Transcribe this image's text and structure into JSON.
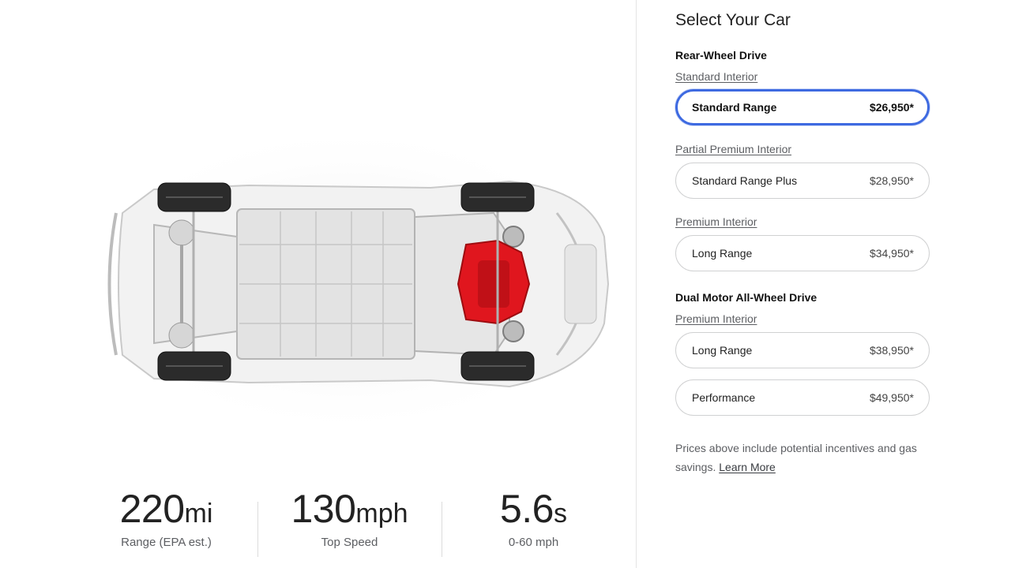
{
  "specs": [
    {
      "value": "220",
      "unit": "mi",
      "label": "Range (EPA est.)"
    },
    {
      "value": "130",
      "unit": "mph",
      "label": "Top Speed"
    },
    {
      "value": "5.6",
      "unit": "s",
      "label": "0-60 mph"
    }
  ],
  "configurator": {
    "title": "Select Your Car",
    "group_rwd": "Rear-Wheel Drive",
    "group_awd": "Dual Motor All-Wheel Drive",
    "interior_standard": "Standard Interior",
    "interior_partial": "Partial Premium Interior",
    "interior_premium_rwd": "Premium Interior",
    "interior_premium_awd": "Premium Interior",
    "options": [
      {
        "name": "Standard Range",
        "price": "$26,950*",
        "selected": true
      },
      {
        "name": "Standard Range Plus",
        "price": "$28,950*",
        "selected": false
      },
      {
        "name": "Long Range",
        "price": "$34,950*",
        "selected": false
      },
      {
        "name": "Long Range",
        "price": "$38,950*",
        "selected": false
      },
      {
        "name": "Performance",
        "price": "$49,950*",
        "selected": false
      }
    ],
    "note_text": "Prices above include potential incentives and gas savings.",
    "learn_more": "Learn More"
  },
  "colors": {
    "accent": "#3e6ae1",
    "motor": "#e0161e"
  }
}
